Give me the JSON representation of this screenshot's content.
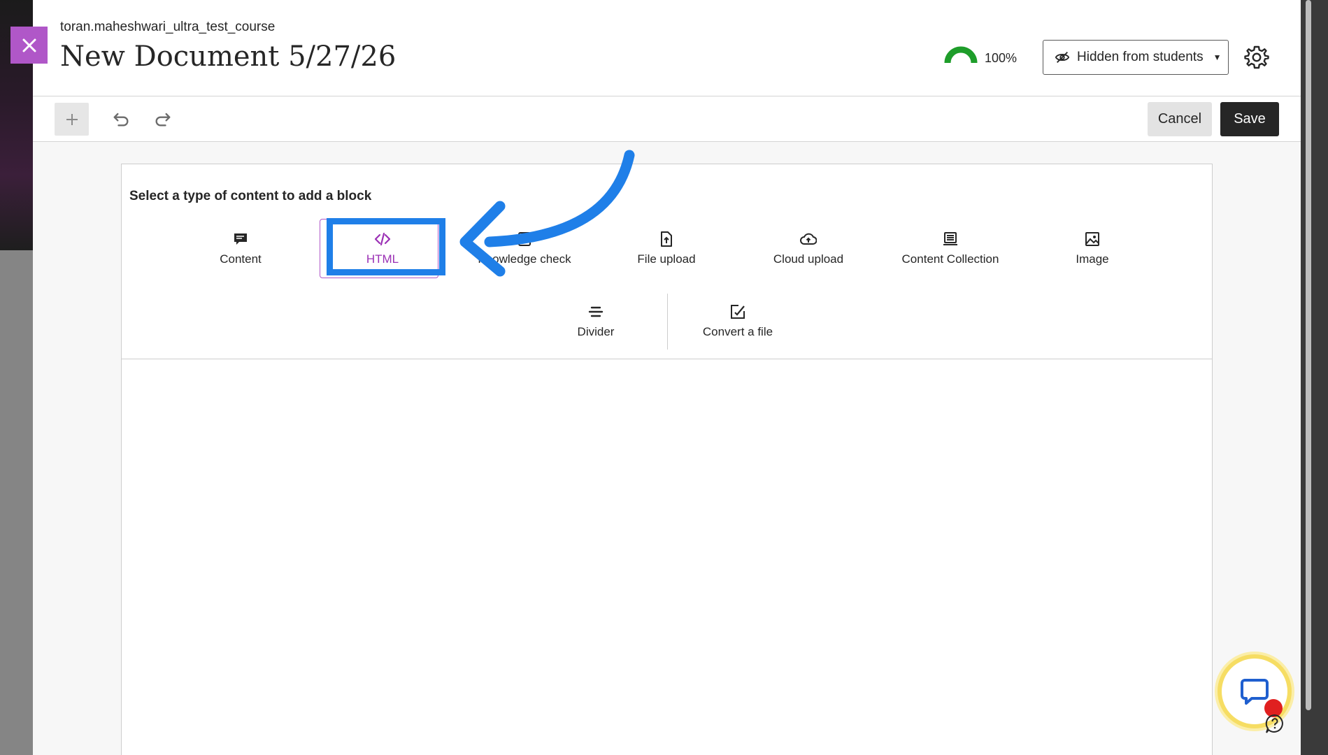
{
  "header": {
    "course_name": "toran.maheshwari_ultra_test_course",
    "doc_title": "New Document 5/27/26",
    "progress_pct": "100%",
    "progress_value": 1.0,
    "visibility_label": "Hidden from students"
  },
  "toolbar": {
    "cancel_label": "Cancel",
    "save_label": "Save"
  },
  "picker": {
    "heading": "Select a type of content to add a block",
    "options": [
      {
        "label": "Content",
        "icon": "content-icon"
      },
      {
        "label": "HTML",
        "icon": "code-icon",
        "selected": true
      },
      {
        "label": "Knowledge check",
        "icon": "knowledge-check-icon"
      },
      {
        "label": "File upload",
        "icon": "file-upload-icon"
      },
      {
        "label": "Cloud upload",
        "icon": "cloud-upload-icon"
      },
      {
        "label": "Content Collection",
        "icon": "content-collection-icon"
      },
      {
        "label": "Image",
        "icon": "image-icon"
      },
      {
        "label": "Divider",
        "icon": "divider-icon"
      },
      {
        "label": "Convert a file",
        "icon": "convert-file-icon"
      }
    ]
  },
  "colors": {
    "accent_purple": "#b057c8",
    "annotation_blue": "#1f7fe8",
    "progress_green": "#1e9d2a"
  }
}
